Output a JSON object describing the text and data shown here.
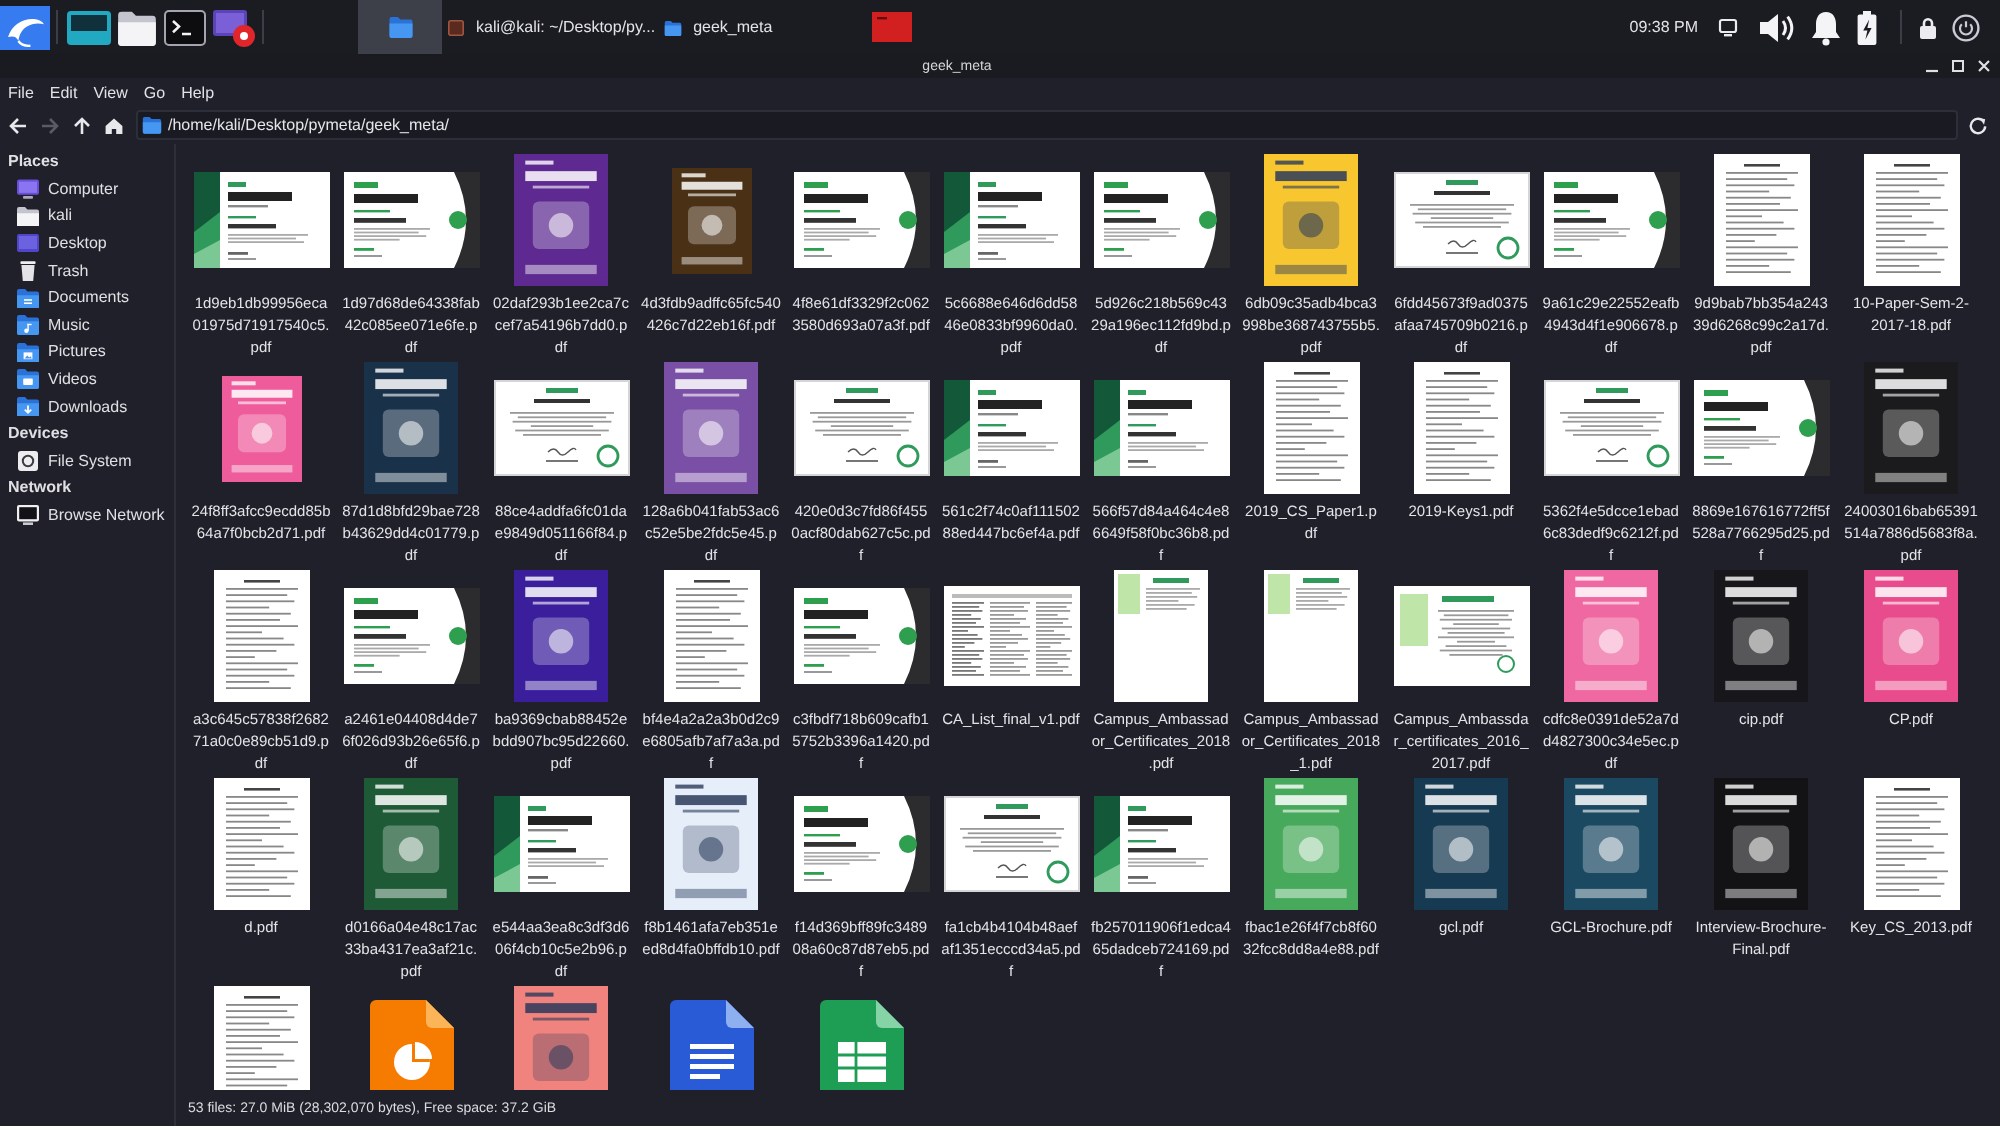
{
  "panel": {
    "workspaces": [
      {
        "selected": true
      }
    ],
    "tasks": [
      {
        "kind": "terminal",
        "label": "kali@kali: ~/Desktop/py..."
      },
      {
        "kind": "file-manager",
        "label": "geek_meta"
      },
      {
        "kind": "app"
      }
    ],
    "clock": "09:38 PM"
  },
  "window": {
    "title": "geek_meta"
  },
  "menu": [
    "File",
    "Edit",
    "View",
    "Go",
    "Help"
  ],
  "toolbar": {
    "nav_buttons": [
      {
        "kind": "back",
        "disabled": false
      },
      {
        "kind": "forward",
        "disabled": true
      },
      {
        "kind": "up",
        "disabled": false
      },
      {
        "kind": "home",
        "disabled": false
      }
    ],
    "path": {
      "value": "/home/kali/Desktop/pymeta/geek_meta/"
    }
  },
  "sidebar": {
    "sections": [
      {
        "title": "Places",
        "items": [
          {
            "label": "Computer",
            "kind": "computer"
          },
          {
            "label": "kali",
            "kind": "home"
          },
          {
            "label": "Desktop",
            "kind": "desktop"
          },
          {
            "label": "Trash",
            "kind": "trash"
          },
          {
            "label": "Documents",
            "kind": "documents"
          },
          {
            "label": "Music",
            "kind": "music"
          },
          {
            "label": "Pictures",
            "kind": "pictures"
          },
          {
            "label": "Videos",
            "kind": "videos"
          },
          {
            "label": "Downloads",
            "kind": "downloads"
          }
        ]
      },
      {
        "title": "Devices",
        "items": [
          {
            "label": "File System",
            "kind": "drive"
          }
        ]
      },
      {
        "title": "Network",
        "items": [
          {
            "label": "Browse Network",
            "kind": "network"
          }
        ]
      }
    ]
  },
  "files": [
    {
      "name": "1d9eb1db99956eca01975d71917540c5.pdf",
      "kind": "certificate"
    },
    {
      "name": "1d97d68de64338fab42c085ee071e6fe.pdf",
      "kind": "certificate-alt"
    },
    {
      "name": "02daf293b1ee2ca7ccef7a54196b7dd0.pdf",
      "kind": "cover",
      "color": "#5e2a91"
    },
    {
      "name": "4d3fdb9adffc65fc540426c7d22eb16f.pdf",
      "kind": "cover-small",
      "color": "#4a3015"
    },
    {
      "name": "4f8e61df3329f2c0623580d693a07a3f.pdf",
      "kind": "certificate-alt"
    },
    {
      "name": "5c6688e646d6dd5846e0833bf9960da0.pdf",
      "kind": "certificate"
    },
    {
      "name": "5d926c218b569c4329a196ec112fd9bd.pdf",
      "kind": "certificate-alt"
    },
    {
      "name": "6db09c35adb4bca3998be368743755b5.pdf",
      "kind": "cover",
      "color": "#f8c730"
    },
    {
      "name": "6fdd45673f9ad0375afaa745709b0216.pdf",
      "kind": "certificate-plain"
    },
    {
      "name": "9a61c29e22552eafb4943d4f1e906678.pdf",
      "kind": "certificate-alt"
    },
    {
      "name": "9d9bab7bb354a24339d6268c99c2a17d.pdf",
      "kind": "page"
    },
    {
      "name": "10-Paper-Sem-2-2017-18.pdf",
      "kind": "page"
    },
    {
      "name": "24f8ff3afcc9ecdd85b64a7f0bcb2d71.pdf",
      "kind": "cover-small",
      "color": "#ee5c9c"
    },
    {
      "name": "87d1d8bfd29bae728b43629dd4c01779.pdf",
      "kind": "cover",
      "color": "#19324a"
    },
    {
      "name": "88ce4addfa6fc01dae9849d051166f84.pdf",
      "kind": "certificate-plain"
    },
    {
      "name": "128a6b041fab53ac6c52e5be2fdc5e45.pdf",
      "kind": "cover",
      "color": "#7a50a6"
    },
    {
      "name": "420e0d3c7fd86f4550acf80dab627c5c.pdf",
      "kind": "certificate-plain"
    },
    {
      "name": "561c2f74c0af11150288ed447bc6ef4a.pdf",
      "kind": "certificate"
    },
    {
      "name": "566f57d84a464c4e86649f58f0bc36b8.pdf",
      "kind": "certificate"
    },
    {
      "name": "2019_CS_Paper1.pdf",
      "kind": "page"
    },
    {
      "name": "2019-Keys1.pdf",
      "kind": "page"
    },
    {
      "name": "5362f4e5dcce1ebad6c83dedf9c6212f.pdf",
      "kind": "certificate-plain"
    },
    {
      "name": "8869e167616772ff5f528a7766295d25.pdf",
      "kind": "certificate-alt"
    },
    {
      "name": "24003016bab65391514a7886d5683f8a.pdf",
      "kind": "cover",
      "color": "#1b1b1d"
    },
    {
      "name": "a3c645c57838f268271a0c0e89cb51d9.pdf",
      "kind": "page"
    },
    {
      "name": "a2461e04408d4de76f026d93b26e65f6.pdf",
      "kind": "certificate-alt"
    },
    {
      "name": "ba9369cbab88452ebdd907bc95d22660.pdf",
      "kind": "cover",
      "color": "#3a1e9c"
    },
    {
      "name": "bf4e4a2a2a3b0d2c9e6805afb7af7a3a.pdf",
      "kind": "page"
    },
    {
      "name": "c3fbdf718b609cafb15752b3396a1420.pdf",
      "kind": "certificate-alt"
    },
    {
      "name": "CA_List_final_v1.pdf",
      "kind": "table-page"
    },
    {
      "name": "Campus_Ambassador_Certificates_2018.pdf",
      "kind": "ambassador-page"
    },
    {
      "name": "Campus_Ambassador_Certificates_2018_1.pdf",
      "kind": "ambassador-page"
    },
    {
      "name": "Campus_Ambassdar_certificates_2016_2017.pdf",
      "kind": "ambassador-sheet"
    },
    {
      "name": "cdfc8e0391de52a7dd4827300c34e5ec.pdf",
      "kind": "cover",
      "color": "#ef68a1"
    },
    {
      "name": "cip.pdf",
      "kind": "cover",
      "color": "#17171b"
    },
    {
      "name": "CP.pdf",
      "kind": "cover",
      "color": "#e94c8c"
    },
    {
      "name": "d.pdf",
      "kind": "page"
    },
    {
      "name": "d0166a04e48c17ac33ba4317ea3af21c.pdf",
      "kind": "cover",
      "color": "#1d5a35"
    },
    {
      "name": "e544aa3ea8c3df3d606f4cb10c5e2b96.pdf",
      "kind": "certificate"
    },
    {
      "name": "f8b1461afa7eb351eed8d4fa0bffdb10.pdf",
      "kind": "cover",
      "color": "#e6eef9"
    },
    {
      "name": "f14d369bff89fc348908a60c87d87eb5.pdf",
      "kind": "certificate-alt"
    },
    {
      "name": "fa1cb4b4104b48aefaf1351ecccd34a5.pdf",
      "kind": "certificate-plain"
    },
    {
      "name": "fb257011906f1edca465dadceb724169.pdf",
      "kind": "certificate"
    },
    {
      "name": "fbac1e26f4f7cb8f6032fcc8dd8a4e88.pdf",
      "kind": "cover",
      "color": "#47a95b"
    },
    {
      "name": "gcl.pdf",
      "kind": "cover",
      "color": "#163a52"
    },
    {
      "name": "GCL-Brochure.pdf",
      "kind": "cover",
      "color": "#1b4961"
    },
    {
      "name": "Interview-Brochure-Final.pdf",
      "kind": "cover",
      "color": "#131316"
    },
    {
      "name": "Key_CS_2013.pdf",
      "kind": "page"
    },
    {
      "kind": "page"
    },
    {
      "kind": "slides-file"
    },
    {
      "kind": "cover",
      "color": "#f1837f"
    },
    {
      "kind": "doc-file"
    },
    {
      "kind": "sheet-file"
    }
  ],
  "status_bar": "53 files: 27.0 MiB (28,302,070 bytes), Free space: 37.2 GiB"
}
